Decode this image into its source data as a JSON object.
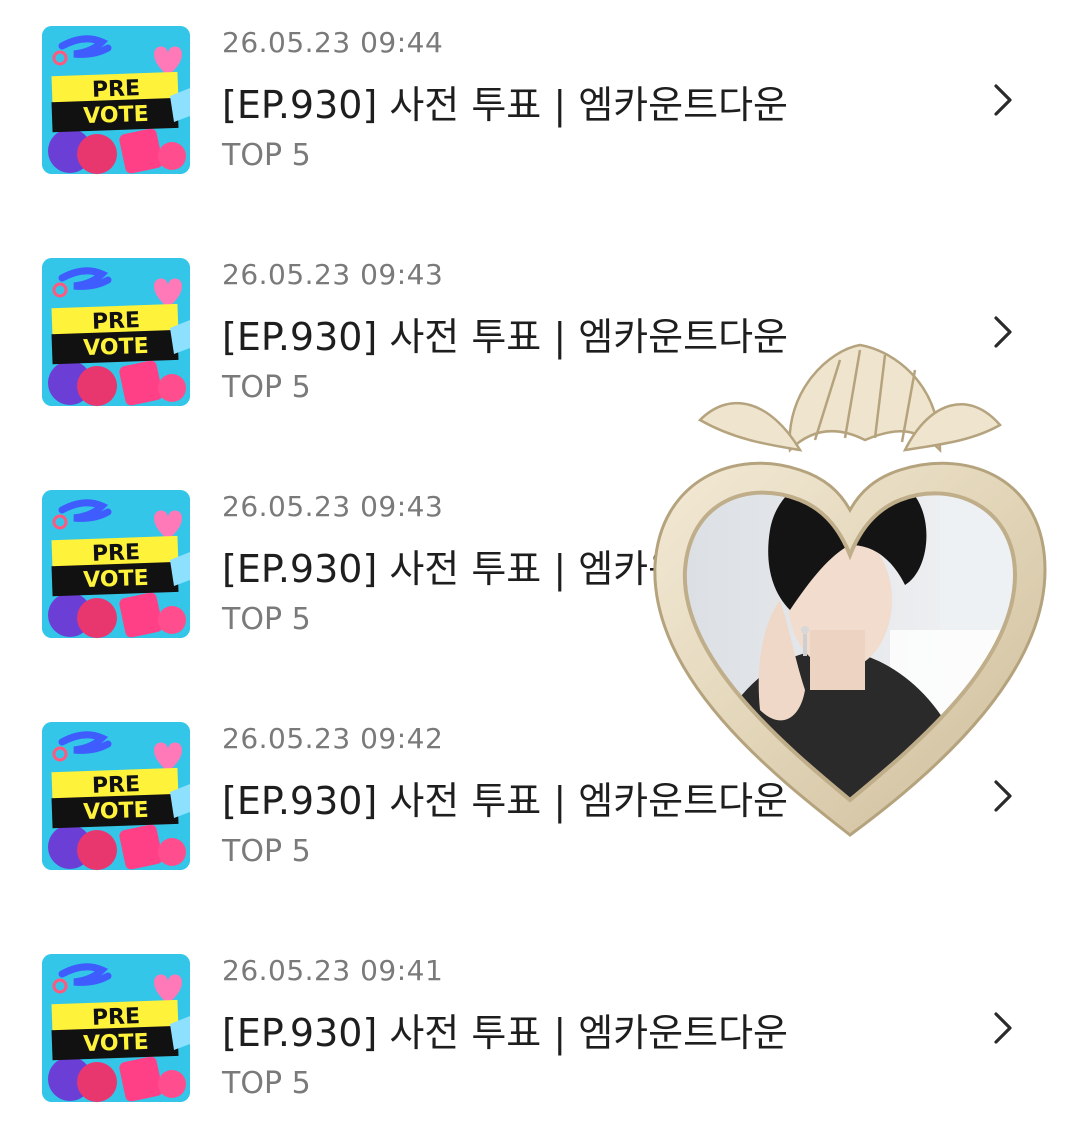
{
  "items": [
    {
      "date": "26.05.23 09:44",
      "title": "[EP.930] 사전 투표 | 엠카운트다운",
      "subtitle": "TOP 5",
      "thumb_line1": "PRE",
      "thumb_line2": "VOTE"
    },
    {
      "date": "26.05.23 09:43",
      "title": "[EP.930] 사전 투표 | 엠카운트다운",
      "subtitle": "TOP 5",
      "thumb_line1": "PRE",
      "thumb_line2": "VOTE"
    },
    {
      "date": "26.05.23 09:43",
      "title": "[EP.930] 사전 투표 | 엠카운트다운",
      "subtitle": "TOP 5",
      "thumb_line1": "PRE",
      "thumb_line2": "VOTE"
    },
    {
      "date": "26.05.23 09:42",
      "title": "[EP.930] 사전 투표 | 엠카운트다운",
      "subtitle": "TOP 5",
      "thumb_line1": "PRE",
      "thumb_line2": "VOTE"
    },
    {
      "date": "26.05.23 09:41",
      "title": "[EP.930] 사전 투표 | 엠카운트다운",
      "subtitle": "TOP 5",
      "thumb_line1": "PRE",
      "thumb_line2": "VOTE"
    }
  ],
  "icons": {
    "row_action": "chevron-right-icon",
    "sticker": "heart-mirror-sticker"
  },
  "colors": {
    "thumb_bg": "#34c6e8",
    "thumb_banner_yellow": "#fff23a",
    "thumb_banner_black": "#111111",
    "text_primary": "#1e1e1e",
    "text_secondary": "#7a7a7a"
  }
}
